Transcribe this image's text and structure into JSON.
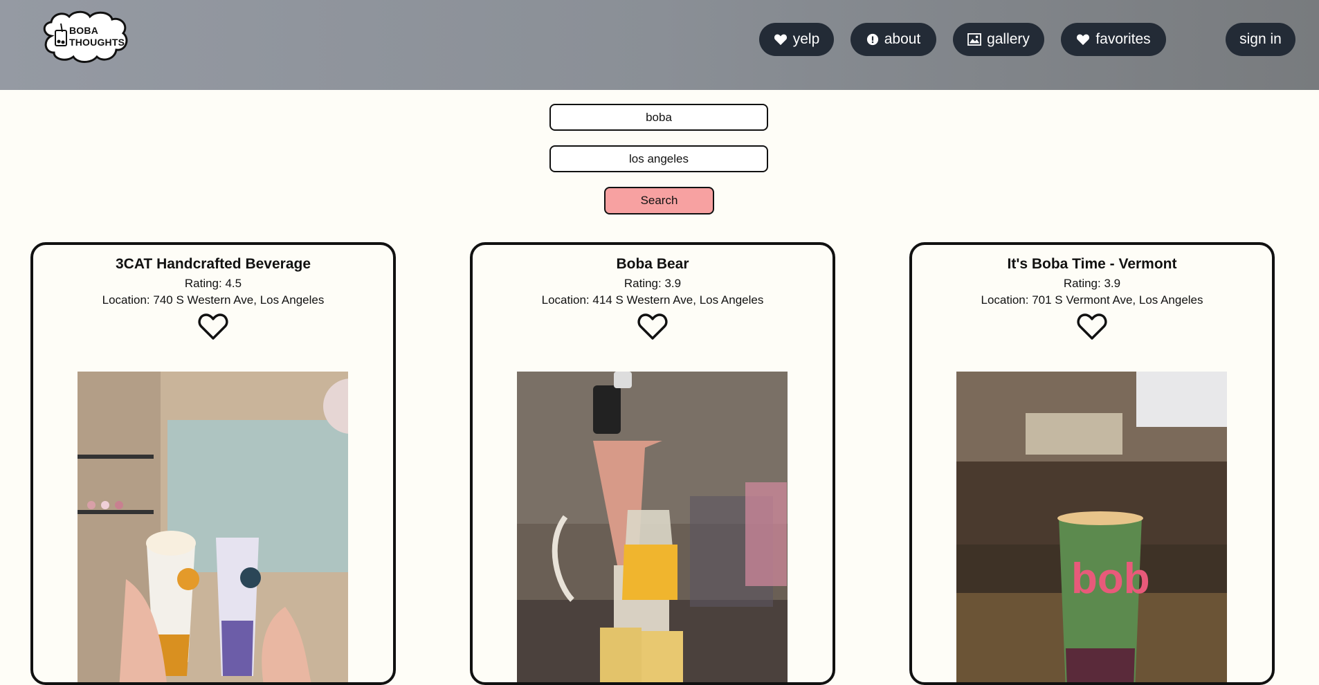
{
  "brand": {
    "logo_text_line1": "BOBA",
    "logo_text_line2": "THOUGHTS"
  },
  "nav": {
    "yelp": {
      "label": "yelp",
      "icon": "heart-icon"
    },
    "about": {
      "label": "about",
      "icon": "info-icon"
    },
    "gallery": {
      "label": "gallery",
      "icon": "image-icon"
    },
    "favorites": {
      "label": "favorites",
      "icon": "heart-icon"
    },
    "sign_in": {
      "label": "sign in"
    }
  },
  "search": {
    "term_value": "boba",
    "location_value": "los angeles",
    "button_label": "Search"
  },
  "results": [
    {
      "name": "3CAT Handcrafted Beverage",
      "rating": "Rating: 4.5",
      "location": "Location: 740 S Western Ave, Los Angeles"
    },
    {
      "name": "Boba Bear",
      "rating": "Rating: 3.9",
      "location": "Location: 414 S Western Ave, Los Angeles"
    },
    {
      "name": "It's Boba Time - Vermont",
      "rating": "Rating: 3.9",
      "location": "Location: 701 S Vermont Ave, Los Angeles"
    }
  ],
  "colors": {
    "page_bg": "#fefdf7",
    "nav_button_bg": "#232b36",
    "search_button_bg": "#f7a1a1"
  }
}
